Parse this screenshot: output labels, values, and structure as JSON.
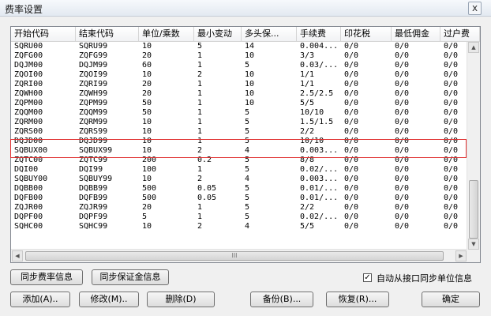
{
  "window": {
    "title": "费率设置",
    "close_glyph": "x"
  },
  "table": {
    "columns": [
      "开始代码",
      "结束代码",
      "单位/乘数",
      "最小变动",
      "多头保...",
      "手续费",
      "印花税",
      "最低佣金",
      "过户费"
    ],
    "rows": [
      [
        "SQRU00",
        "SQRU99",
        "10",
        "5",
        "14",
        "0.004...",
        "0/0",
        "0/0",
        "0/0"
      ],
      [
        "ZQFG00",
        "ZQFG99",
        "20",
        "1",
        "10",
        "3/3",
        "0/0",
        "0/0",
        "0/0"
      ],
      [
        "DQJM00",
        "DQJM99",
        "60",
        "1",
        "5",
        "0.03/...",
        "0/0",
        "0/0",
        "0/0"
      ],
      [
        "ZQOI00",
        "ZQOI99",
        "10",
        "2",
        "10",
        "1/1",
        "0/0",
        "0/0",
        "0/0"
      ],
      [
        "ZQRI00",
        "ZQRI99",
        "20",
        "1",
        "10",
        "1/1",
        "0/0",
        "0/0",
        "0/0"
      ],
      [
        "ZQWH00",
        "ZQWH99",
        "20",
        "1",
        "10",
        "2.5/2.5",
        "0/0",
        "0/0",
        "0/0"
      ],
      [
        "ZQPM00",
        "ZQPM99",
        "50",
        "1",
        "10",
        "5/5",
        "0/0",
        "0/0",
        "0/0"
      ],
      [
        "ZQQM00",
        "ZQQM99",
        "50",
        "1",
        "5",
        "10/10",
        "0/0",
        "0/0",
        "0/0"
      ],
      [
        "ZQRM00",
        "ZQRM99",
        "10",
        "1",
        "5",
        "1.5/1.5",
        "0/0",
        "0/0",
        "0/0"
      ],
      [
        "ZQRS00",
        "ZQRS99",
        "10",
        "1",
        "5",
        "2/2",
        "0/0",
        "0/0",
        "0/0"
      ],
      [
        "DQJD00",
        "DQJD99",
        "10",
        "1",
        "5",
        "10/10",
        "0/0",
        "0/0",
        "0/0"
      ],
      [
        "SQBUX00",
        "SQBUX99",
        "10",
        "2",
        "4",
        "0.003...",
        "0/0",
        "0/0",
        "0/0"
      ],
      [
        "ZQTC00",
        "ZQTC99",
        "200",
        "0.2",
        "5",
        "8/8",
        "0/0",
        "0/0",
        "0/0"
      ],
      [
        "DQI00",
        "DQI99",
        "100",
        "1",
        "5",
        "0.02/...",
        "0/0",
        "0/0",
        "0/0"
      ],
      [
        "SQBUY00",
        "SQBUY99",
        "10",
        "2",
        "4",
        "0.003...",
        "0/0",
        "0/0",
        "0/0"
      ],
      [
        "DQBB00",
        "DQBB99",
        "500",
        "0.05",
        "5",
        "0.01/...",
        "0/0",
        "0/0",
        "0/0"
      ],
      [
        "DQFB00",
        "DQFB99",
        "500",
        "0.05",
        "5",
        "0.01/...",
        "0/0",
        "0/0",
        "0/0"
      ],
      [
        "ZQJR00",
        "ZQJR99",
        "20",
        "1",
        "5",
        "2/2",
        "0/0",
        "0/0",
        "0/0"
      ],
      [
        "DQPF00",
        "DQPF99",
        "5",
        "1",
        "5",
        "0.02/...",
        "0/0",
        "0/0",
        "0/0"
      ],
      [
        "SQHC00",
        "SQHC99",
        "10",
        "2",
        "4",
        "5/5",
        "0/0",
        "0/0",
        "0/0"
      ]
    ]
  },
  "scroll": {
    "hthumb_grip": "III",
    "up": "▲",
    "down": "▼",
    "left": "◀",
    "right": "▶"
  },
  "buttons": {
    "sync_fee": "同步费率信息",
    "sync_margin": "同步保证金信息",
    "add": "添加(A)..",
    "modify": "修改(M)..",
    "delete": "删除(D)",
    "backup": "备份(B)...",
    "restore": "恢复(R)...",
    "ok": "确定"
  },
  "auto_sync": {
    "label": "自动从接口同步单位信息",
    "checked": true,
    "check_glyph": "✓"
  }
}
